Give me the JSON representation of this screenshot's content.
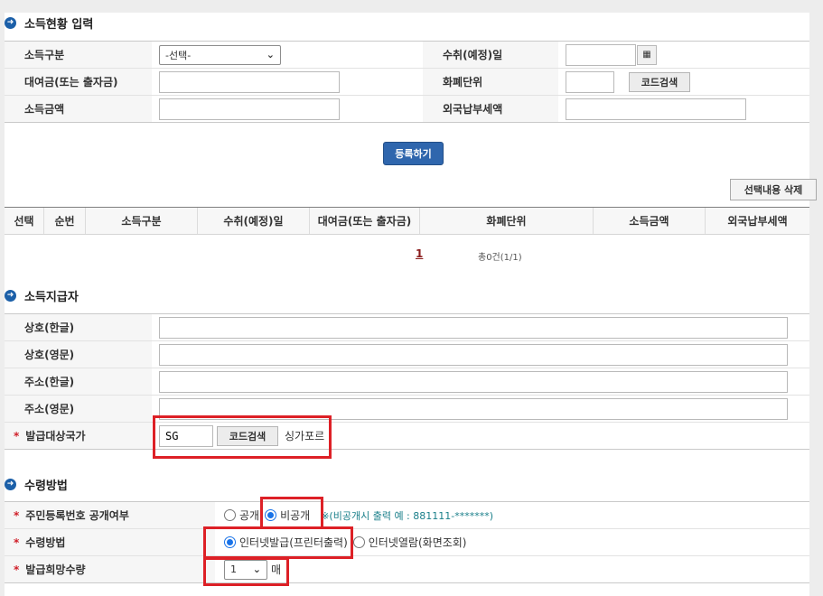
{
  "income_input": {
    "section_title": "소득현황 입력",
    "rows": [
      {
        "label": "소득구분",
        "select_value": "-선택-",
        "label2": "수취(예정)일"
      },
      {
        "label": "대여금(또는 출자금)",
        "label2": "화폐단위",
        "code_button": "코드검색"
      },
      {
        "label": "소득금액",
        "label2": "외국납부세액"
      }
    ],
    "register_button": "등록하기",
    "delete_button": "선택내용 삭제",
    "columns": [
      "선택",
      "순번",
      "소득구분",
      "수취(예정)일",
      "대여금(또는 출자금)",
      "화폐단위",
      "소득금액",
      "외국납부세액"
    ],
    "page_number": "1",
    "total_text": "총0건(1/1)"
  },
  "payer": {
    "section_title": "소득지급자",
    "rows": [
      {
        "label": "상호(한글)"
      },
      {
        "label": "상호(영문)"
      },
      {
        "label": "주소(한글)"
      },
      {
        "label": "주소(영문)"
      }
    ],
    "country": {
      "label": "발급대상국가",
      "required_mark": "*",
      "code_value": "SG",
      "code_button": "코드검색",
      "country_name": "싱가포르"
    }
  },
  "receipt": {
    "section_title": "수령방법",
    "rrn": {
      "label": "주민등록번호 공개여부",
      "required_mark": "*",
      "options": [
        "공개",
        "비공개"
      ],
      "selected": "비공개",
      "note": "※(비공개시 출력 예 : 881111-*******)"
    },
    "method": {
      "label": "수령방법",
      "required_mark": "*",
      "options": [
        "인터넷발급(프린터출력)",
        "인터넷열람(화면조회)"
      ],
      "selected": "인터넷발급(프린터출력)"
    },
    "count": {
      "label": "발급희망수량",
      "required_mark": "*",
      "value": "1",
      "unit": "매"
    }
  },
  "colors": {
    "accent": "#2f66ad",
    "highlight": "#dd2026",
    "required": "#d0202a"
  }
}
